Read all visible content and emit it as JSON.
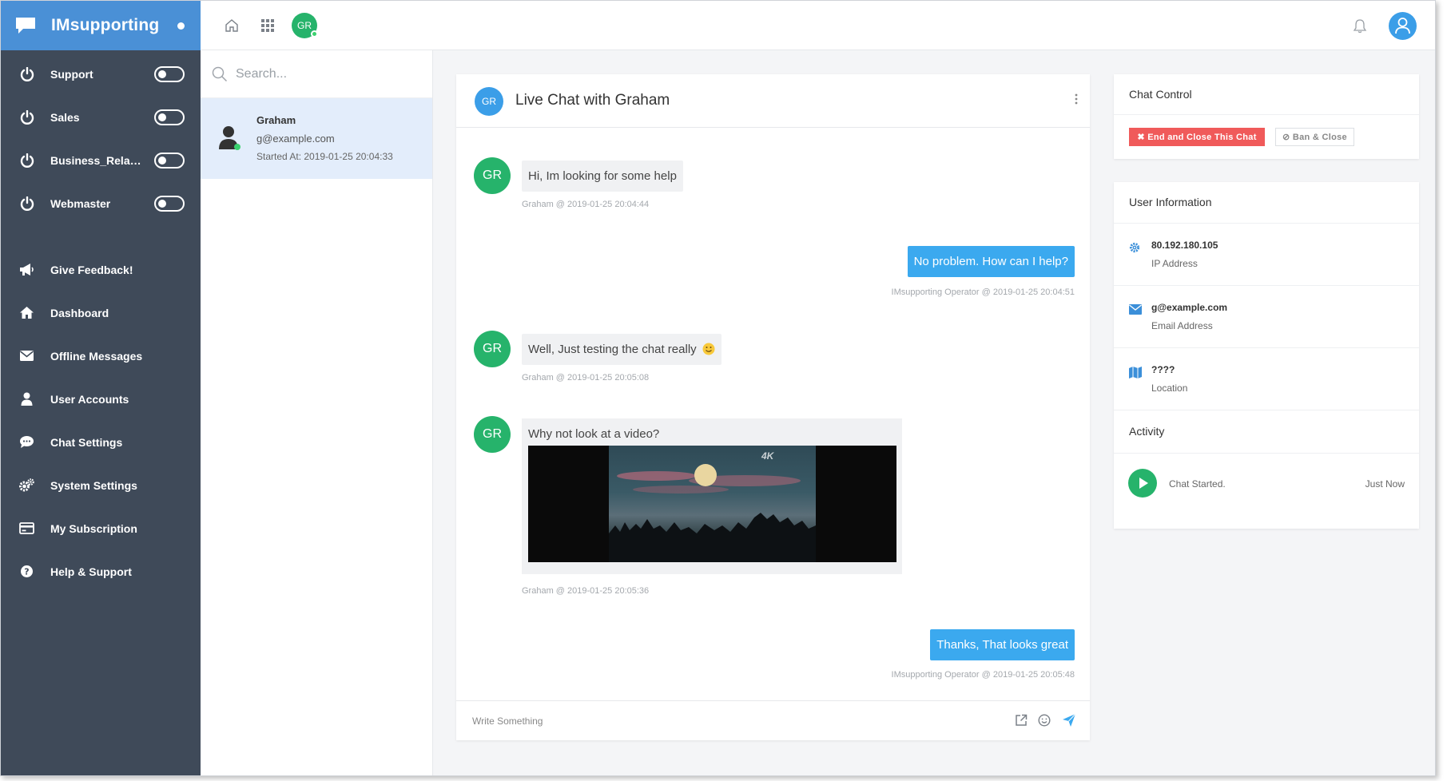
{
  "brand": {
    "name": "IMsupporting"
  },
  "departments": [
    {
      "label": "Support"
    },
    {
      "label": "Sales"
    },
    {
      "label": "Business_Relationships"
    },
    {
      "label": "Webmaster"
    }
  ],
  "nav": [
    {
      "label": "Give Feedback!",
      "icon": "megaphone-icon"
    },
    {
      "label": "Dashboard",
      "icon": "home-icon"
    },
    {
      "label": "Offline Messages",
      "icon": "envelope-icon"
    },
    {
      "label": "User Accounts",
      "icon": "user-icon"
    },
    {
      "label": "Chat Settings",
      "icon": "chat-bubble-icon"
    },
    {
      "label": "System Settings",
      "icon": "gears-icon"
    },
    {
      "label": "My Subscription",
      "icon": "credit-card-icon"
    },
    {
      "label": "Help & Support",
      "icon": "question-circle-icon"
    }
  ],
  "topbar": {
    "avatar_initials": "GR"
  },
  "chat_list": {
    "search_placeholder": "Search...",
    "items": [
      {
        "name": "Graham",
        "email": "g@example.com",
        "started": "Started At: 2019-01-25 20:04:33"
      }
    ]
  },
  "chat": {
    "avatar_initials": "GR",
    "title": "Live Chat with Graham",
    "messages": [
      {
        "from": "visitor",
        "initials": "GR",
        "text": "Hi, Im looking for some help",
        "meta": "Graham @ 2019-01-25 20:04:44"
      },
      {
        "from": "operator",
        "text": "No problem. How can I help?",
        "meta": "IMsupporting Operator @ 2019-01-25 20:04:51"
      },
      {
        "from": "visitor",
        "initials": "GR",
        "text": "Well, Just testing the chat really",
        "meta": "Graham @ 2019-01-25 20:05:08"
      },
      {
        "from": "visitor",
        "initials": "GR",
        "text": "Why not look at a video?",
        "meta": "Graham @ 2019-01-25 20:05:36",
        "video_badge": "4K"
      },
      {
        "from": "operator",
        "text": "Thanks, That looks great",
        "meta": "IMsupporting Operator @ 2019-01-25 20:05:48"
      }
    ],
    "composer_placeholder": "Write Something"
  },
  "chat_control": {
    "title": "Chat Control",
    "end_label": "✖ End and Close This Chat",
    "ban_label": "⊘ Ban & Close"
  },
  "user_info": {
    "title": "User Information",
    "rows": [
      {
        "value": "80.192.180.105",
        "label": "IP Address",
        "icon": "gear-icon"
      },
      {
        "value": "g@example.com",
        "label": "Email Address",
        "icon": "envelope-icon"
      },
      {
        "value": "????",
        "label": "Location",
        "icon": "map-icon"
      }
    ],
    "activity_title": "Activity",
    "activity": [
      {
        "text": "Chat Started.",
        "time": "Just Now"
      }
    ]
  },
  "colors": {
    "sidebar": "#3f4a59",
    "brand": "#4a90d6",
    "operator_bubble": "#3ba9ef",
    "visitor_avatar": "#26b36b",
    "danger": "#f05a5a"
  }
}
